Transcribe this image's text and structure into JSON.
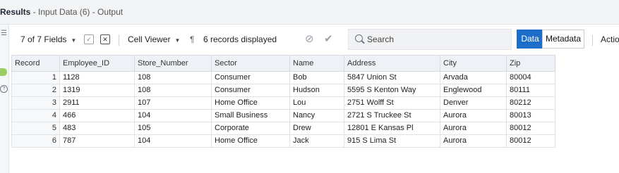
{
  "window": {
    "title_bold": "Results",
    "title_rest": " - Input Data (6) - Output"
  },
  "toolbar": {
    "fields_selector": "7 of 7 Fields",
    "cell_viewer": "Cell Viewer",
    "records_displayed": "6 records displayed",
    "search_placeholder": "Search",
    "view_data": "Data",
    "view_metadata": "Metadata",
    "actions": "Actio"
  },
  "table": {
    "columns": [
      "Record",
      "Employee_ID",
      "Store_Number",
      "Sector",
      "Name",
      "Address",
      "City",
      "Zip"
    ],
    "rows": [
      [
        "1",
        "1128",
        "108",
        "Consumer",
        "Bob",
        "5847 Union St",
        "Arvada",
        "80004"
      ],
      [
        "2",
        "1319",
        "108",
        "Consumer",
        "Hudson",
        "5595 S Kenton Way",
        "Englewood",
        "80111"
      ],
      [
        "3",
        "2911",
        "107",
        "Home Office",
        "Lou",
        "2751 Wolff St",
        "Denver",
        "80212"
      ],
      [
        "4",
        "466",
        "104",
        "Small Business",
        "Nancy",
        "2721 S Truckee St",
        "Aurora",
        "80013"
      ],
      [
        "5",
        "483",
        "105",
        "Corporate",
        "Drew",
        "12801 E Kansas Pl",
        "Aurora",
        "80012"
      ],
      [
        "6",
        "787",
        "104",
        "Home Office",
        "Jack",
        "915 S Lima St",
        "Aurora",
        "80012"
      ]
    ]
  },
  "colors": {
    "accent": "#1c6ec9",
    "header_bg": "#eef1f5",
    "rail_green": "#9ccc65"
  }
}
